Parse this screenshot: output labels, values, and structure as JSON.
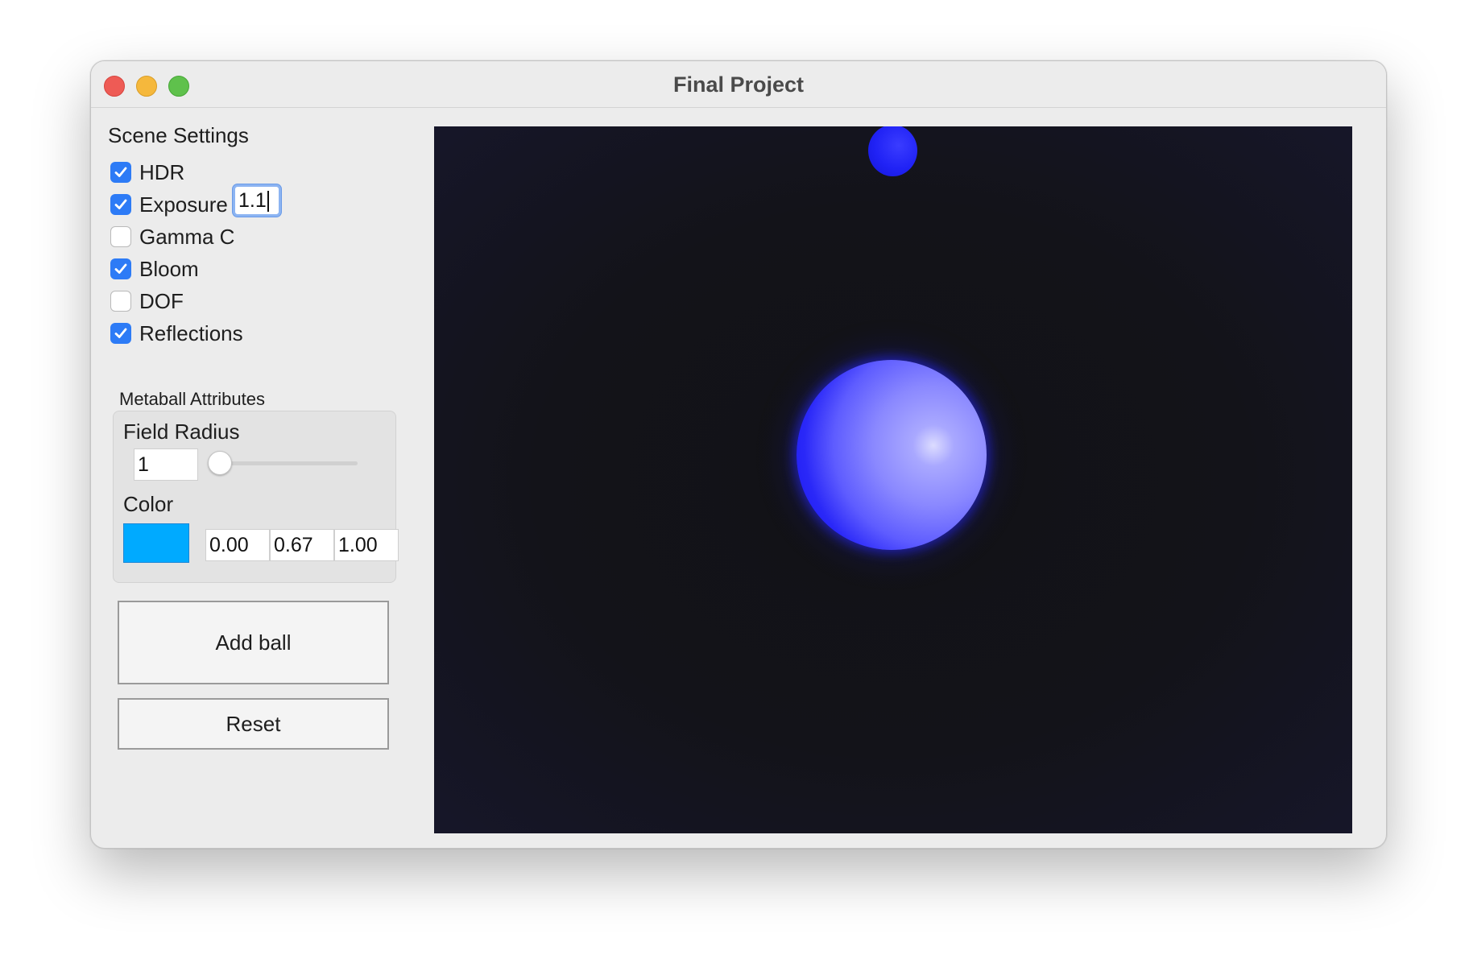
{
  "window": {
    "title": "Final Project"
  },
  "scene_settings": {
    "title": "Scene Settings",
    "options": [
      {
        "label": "HDR",
        "checked": true
      },
      {
        "label": "Exposure",
        "checked": true
      },
      {
        "label": "Gamma C",
        "checked": false
      },
      {
        "label": "Bloom",
        "checked": true
      },
      {
        "label": "DOF",
        "checked": false
      },
      {
        "label": "Reflections",
        "checked": true
      }
    ],
    "exposure_value": "1.1"
  },
  "metaball": {
    "group_title": "Metaball Attributes",
    "field_radius_label": "Field Radius",
    "field_radius_value": "1",
    "slider_level": 0.0,
    "color_label": "Color",
    "swatch_color": "#00aaff",
    "color_r": "0.00",
    "color_g": "0.67",
    "color_b": "1.00"
  },
  "buttons": {
    "add_ball": "Add ball",
    "reset": "Reset"
  },
  "viewport": {
    "background": "#131318",
    "ball_color": "#2a28f8"
  }
}
